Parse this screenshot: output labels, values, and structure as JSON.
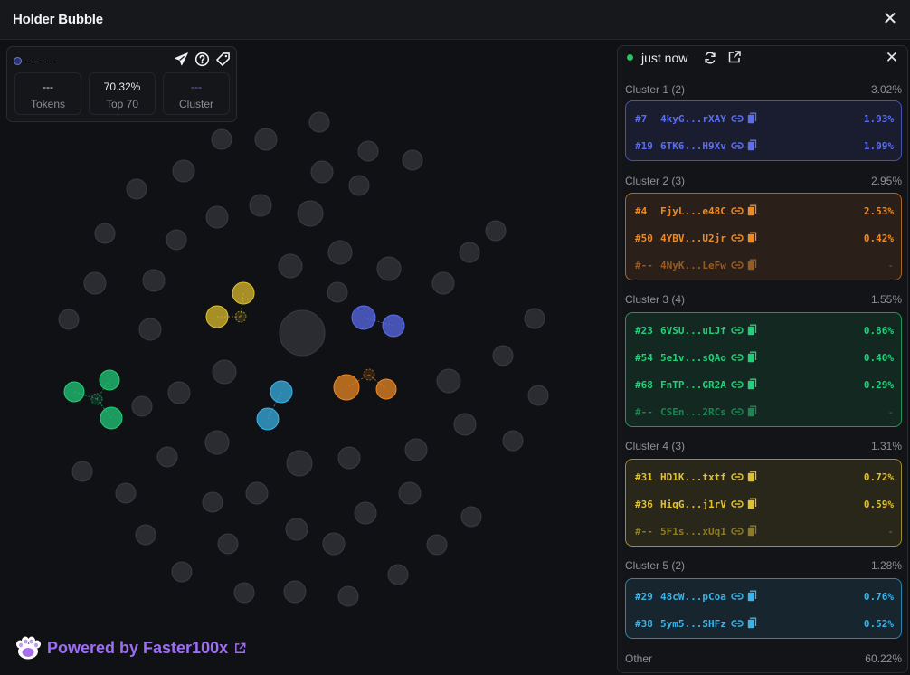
{
  "window": {
    "title": "Holder Bubble",
    "close_glyph": "✕"
  },
  "stats": {
    "name": "---",
    "sub": "---",
    "items": [
      {
        "value": "---",
        "label": "Tokens"
      },
      {
        "value": "70.32%",
        "label": "Top 70"
      },
      {
        "value": "---",
        "label": "Cluster"
      }
    ],
    "icons": [
      "send-icon",
      "help-icon",
      "tag-icon"
    ]
  },
  "brand": {
    "text": "Powered by Faster100x"
  },
  "panel": {
    "updated": "just now",
    "clusters": [
      {
        "name": "Cluster 1 (2)",
        "pct": "3.02%",
        "color": "#5b6ef0",
        "rows": [
          {
            "rank": "#7",
            "addr": "4kyG...rXAY",
            "val": "1.93%"
          },
          {
            "rank": "#19",
            "addr": "6TK6...H9Xv",
            "val": "1.09%"
          }
        ]
      },
      {
        "name": "Cluster 2 (3)",
        "pct": "2.95%",
        "color": "#f08a24",
        "rows": [
          {
            "rank": "#4",
            "addr": "FjyL...e48C",
            "val": "2.53%"
          },
          {
            "rank": "#50",
            "addr": "4YBV...U2jr",
            "val": "0.42%"
          },
          {
            "rank": "#--",
            "addr": "4NyK...LeFw",
            "val": "-",
            "dim": true
          }
        ]
      },
      {
        "name": "Cluster 3 (4)",
        "pct": "1.55%",
        "color": "#22d07a",
        "rows": [
          {
            "rank": "#23",
            "addr": "6VSU...uLJf",
            "val": "0.86%"
          },
          {
            "rank": "#54",
            "addr": "5e1v...sQAo",
            "val": "0.40%"
          },
          {
            "rank": "#68",
            "addr": "FnTP...GR2A",
            "val": "0.29%"
          },
          {
            "rank": "#--",
            "addr": "CSEn...2RCs",
            "val": "-",
            "dim": true
          }
        ]
      },
      {
        "name": "Cluster 4 (3)",
        "pct": "1.31%",
        "color": "#e0c12e",
        "rows": [
          {
            "rank": "#31",
            "addr": "HD1K...txtf",
            "val": "0.72%"
          },
          {
            "rank": "#36",
            "addr": "HiqG...j1rV",
            "val": "0.59%"
          },
          {
            "rank": "#--",
            "addr": "5F1s...xUq1",
            "val": "-",
            "dim": true
          }
        ]
      },
      {
        "name": "Cluster 5 (2)",
        "pct": "1.28%",
        "color": "#3ab4e8",
        "rows": [
          {
            "rank": "#29",
            "addr": "48cW...pCoa",
            "val": "0.76%"
          },
          {
            "rank": "#38",
            "addr": "5ym5...SHFz",
            "val": "0.52%"
          }
        ]
      }
    ],
    "other": {
      "label": "Other",
      "pct": "60.22%"
    }
  }
}
